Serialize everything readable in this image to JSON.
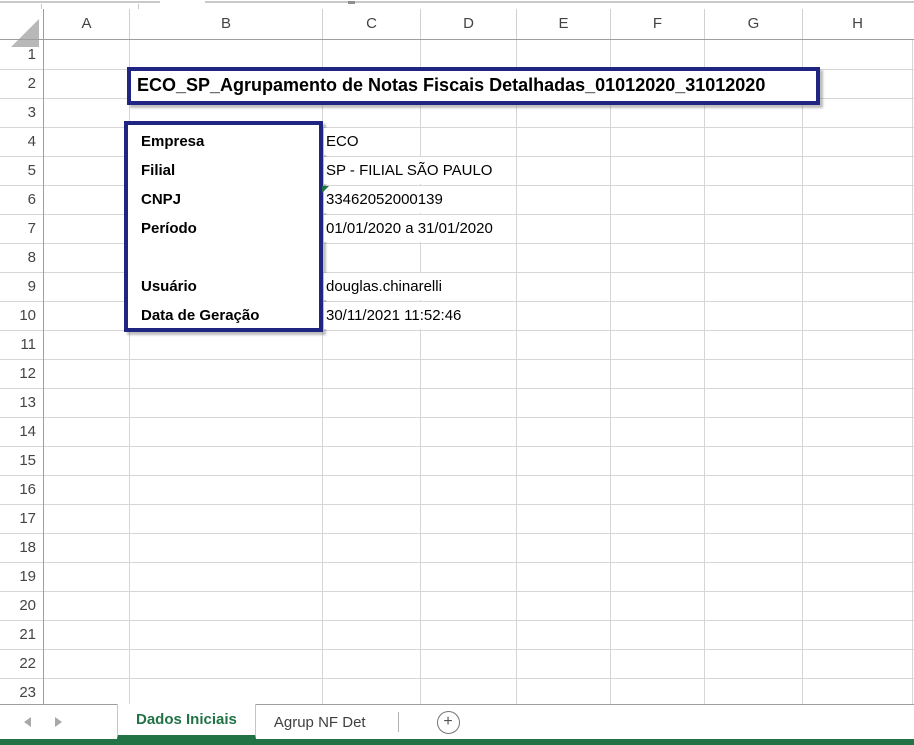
{
  "grid": {
    "columns": [
      "A",
      "B",
      "C",
      "D",
      "E",
      "F",
      "G",
      "H"
    ],
    "rows": [
      1,
      2,
      3,
      4,
      5,
      6,
      7,
      8,
      9,
      10,
      11,
      12,
      13,
      14,
      15,
      16,
      17,
      18,
      19,
      20,
      21,
      22,
      23
    ]
  },
  "title_box": {
    "text": "ECO_SP_Agrupamento de Notas Fiscais Detalhadas_01012020_31012020"
  },
  "info_box": {
    "rows": [
      {
        "label": "Empresa",
        "value": "ECO",
        "error_indicator": false
      },
      {
        "label": "Filial",
        "value": "SP - FILIAL SÃO PAULO",
        "error_indicator": false
      },
      {
        "label": "CNPJ",
        "value": "33462052000139",
        "error_indicator": true
      },
      {
        "label": "Período",
        "value": "01/01/2020 a 31/01/2020",
        "error_indicator": false
      },
      {
        "label": "",
        "value": "",
        "error_indicator": false
      },
      {
        "label": "Usuário",
        "value": "douglas.chinarelli",
        "error_indicator": false
      },
      {
        "label": "Data de Geração",
        "value": "30/11/2021 11:52:46",
        "error_indicator": false
      }
    ]
  },
  "sheet_tabs": {
    "tabs": [
      {
        "label": "Dados Iniciais",
        "active": true
      },
      {
        "label": "Agrup NF Det",
        "active": false
      }
    ],
    "add_sheet_label": "+"
  },
  "icons": {
    "select_all": "select-all-triangle-icon",
    "prev": "prev-sheet-arrow-icon",
    "next": "next-sheet-arrow-icon",
    "add": "plus-circle-icon",
    "error": "error-indicator-triangle-icon"
  },
  "colors": {
    "excel_green": "#217346",
    "box_border_navy": "#1f2581",
    "gridline": "#d6d6d6",
    "header_text": "#444444",
    "error_indicator_green": "#1e7145"
  }
}
